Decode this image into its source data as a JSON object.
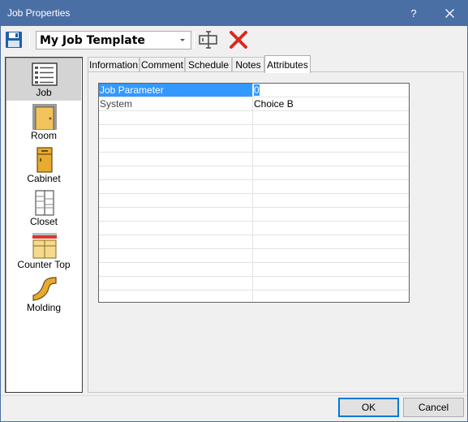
{
  "window": {
    "title": "Job Properties",
    "help_label": "?",
    "accent_color": "#4a6fa5"
  },
  "toolbar": {
    "template_value": "My Job Template"
  },
  "icons": {
    "save": "floppy-disk-icon",
    "dropdown": "chevron-down-icon",
    "properties": "properties-icon",
    "delete": "red-x-delete-icon",
    "close": "close-icon"
  },
  "sidebar": {
    "items": [
      {
        "label": "Job",
        "icon": "job-clipboard-icon",
        "selected": true
      },
      {
        "label": "Room",
        "icon": "room-door-icon"
      },
      {
        "label": "Cabinet",
        "icon": "cabinet-icon"
      },
      {
        "label": "Closet",
        "icon": "closet-icon"
      },
      {
        "label": "Counter Top",
        "icon": "counter-top-icon"
      },
      {
        "label": "Molding",
        "icon": "molding-icon"
      }
    ]
  },
  "tabs": [
    {
      "label": "Information"
    },
    {
      "label": "Comment"
    },
    {
      "label": "Schedule"
    },
    {
      "label": "Notes"
    },
    {
      "label": "Attributes",
      "active": true
    }
  ],
  "grid": {
    "rows": [
      {
        "name": "Job Parameter",
        "value": "0"
      },
      {
        "name": "System",
        "value": "Choice B"
      }
    ]
  },
  "buttons": {
    "ok": "OK",
    "cancel": "Cancel"
  }
}
